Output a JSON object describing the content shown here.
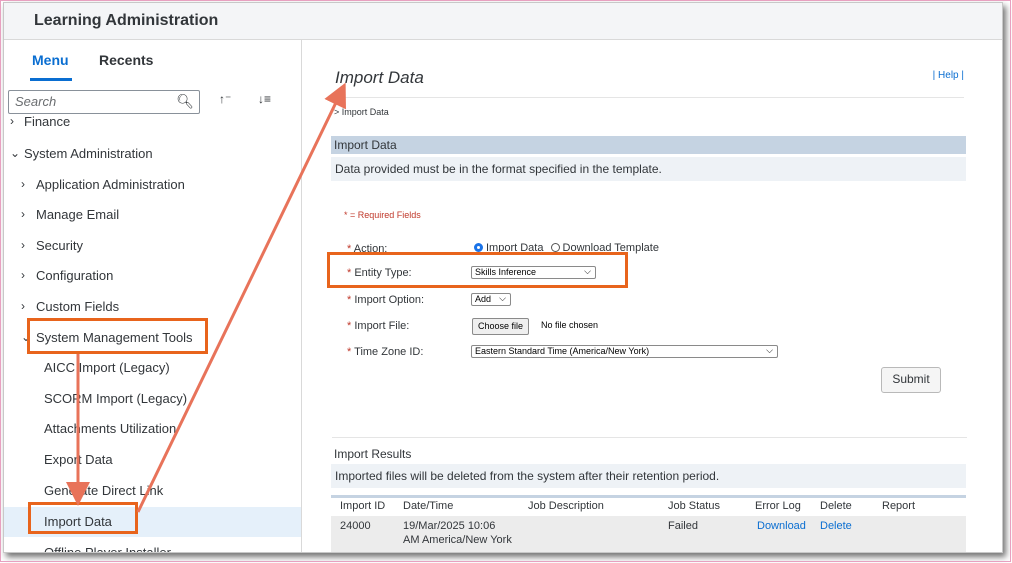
{
  "app": {
    "title": "Learning Administration"
  },
  "sidebar": {
    "tabs": [
      {
        "label": "Menu"
      },
      {
        "label": "Recents"
      }
    ],
    "search_placeholder": "Search",
    "items": [
      {
        "label": "Finance",
        "level": 0,
        "expanded": false
      },
      {
        "label": "System Administration",
        "level": 0,
        "expanded": true
      },
      {
        "label": "Application Administration",
        "level": 1,
        "expanded": false
      },
      {
        "label": "Manage Email",
        "level": 1,
        "expanded": false
      },
      {
        "label": "Security",
        "level": 1,
        "expanded": false
      },
      {
        "label": "Configuration",
        "level": 1,
        "expanded": false
      },
      {
        "label": "Custom Fields",
        "level": 1,
        "expanded": false
      },
      {
        "label": "System Management Tools",
        "level": 1,
        "expanded": true
      },
      {
        "label": "AICC Import (Legacy)",
        "level": 2
      },
      {
        "label": "SCORM Import (Legacy)",
        "level": 2
      },
      {
        "label": "Attachments Utilization",
        "level": 2
      },
      {
        "label": "Export Data",
        "level": 2
      },
      {
        "label": "Generate Direct Link",
        "level": 2
      },
      {
        "label": "Import Data",
        "level": 2,
        "selected": true
      },
      {
        "label": "Offline Player Installer",
        "level": 2
      }
    ]
  },
  "main": {
    "title": "Import Data",
    "help": "Help",
    "breadcrumb": "> Import Data",
    "section": {
      "title": "Import Data",
      "description": "Data provided must be in the format specified in the template."
    },
    "required_note": "* = Required Fields",
    "form": {
      "action_label": "Action:",
      "action_options": [
        {
          "label": "Import Data",
          "selected": true
        },
        {
          "label": "Download Template",
          "selected": false
        }
      ],
      "entity_type_label": "Entity Type:",
      "entity_type_value": "Skills Inference",
      "import_option_label": "Import Option:",
      "import_option_value": "Add",
      "import_file_label": "Import File:",
      "choose_file_label": "Choose file",
      "file_status": "No file chosen",
      "time_zone_label": "Time Zone ID:",
      "time_zone_value": "Eastern Standard Time (America/New York)",
      "submit_label": "Submit"
    },
    "results": {
      "title": "Import Results",
      "description": "Imported files will be deleted from the system after their retention period.",
      "columns": [
        "Import ID",
        "Date/Time",
        "Job Description",
        "Job Status",
        "Error Log",
        "Delete",
        "Report"
      ],
      "rows": [
        {
          "import_id": "24000",
          "datetime": "19/Mar/2025 10:06 AM America/New York",
          "job_description": "",
          "job_status": "Failed",
          "error_log": "Download",
          "delete": "Delete",
          "report": ""
        }
      ]
    }
  },
  "annotations": {
    "highlight_color": "#e8641c",
    "arrow_color": "#e8735a"
  }
}
